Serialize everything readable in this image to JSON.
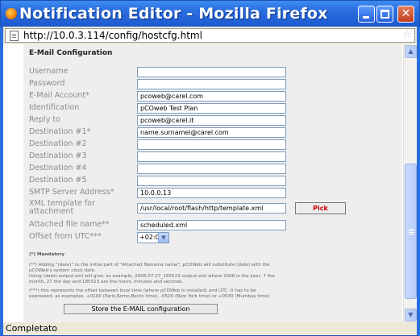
{
  "window": {
    "title": "Notification Editor - Mozilla Firefox",
    "url": "http://10.0.3.114/config/hostcfg.html",
    "status": "Completato"
  },
  "form": {
    "section_title": "E-Mail Configuration",
    "fields": [
      {
        "label": "Username",
        "value": ""
      },
      {
        "label": "Password",
        "value": ""
      },
      {
        "label": "E-Mail Account*",
        "value": "pcoweb@carel.com"
      },
      {
        "label": "Identification",
        "value": "pCOweb Test Plan"
      },
      {
        "label": "Reply to",
        "value": "pcoweb@carel.it"
      },
      {
        "label": "Destination #1*",
        "value": "name.surnamei@carel.com"
      },
      {
        "label": "Destination #2",
        "value": ""
      },
      {
        "label": "Destination #3",
        "value": ""
      },
      {
        "label": "Destination #4",
        "value": ""
      },
      {
        "label": "Destination #5",
        "value": ""
      },
      {
        "label": "SMTP Server Address*",
        "value": "10.0.0.13"
      }
    ],
    "xml_template": {
      "label_line1": "XML template for",
      "label_line2": "attachment",
      "value": "/usr/local/root/flash/http/template.xml",
      "pick_label": "Pick"
    },
    "attached_file": {
      "label": "Attached file name**",
      "value": "scheduled.xml"
    },
    "offset": {
      "label": "Offset from UTC***",
      "value": "+02:00"
    },
    "notes": {
      "mandatory": "(*) Mandatory",
      "note2_line1": "(**) Adding \"(date)\" to the initial part of \"Attached filename name\", pCOWeb will substitute (date) with the",
      "note2_line2": "pCOWeb's system clock date.",
      "note2_line3": "Using (date)-output.xml will give, as example, 2006-07-27_185523-output.xml where 2006 is the year, 7 the",
      "note2_line4": "month, 27 the day and 185523 are the hours, minutes and seconds.",
      "note3_line1": "(***) this represents the offset between local time (where pCOWeb is installed) and UTC. It has to be",
      "note3_line2": "expressed, as examples, +0100 (Paris,Rome,Berlin time), -0500 (New York time) or +0530 (Mumbay time)."
    },
    "store_label": "Store the E-MAIL configuration"
  }
}
